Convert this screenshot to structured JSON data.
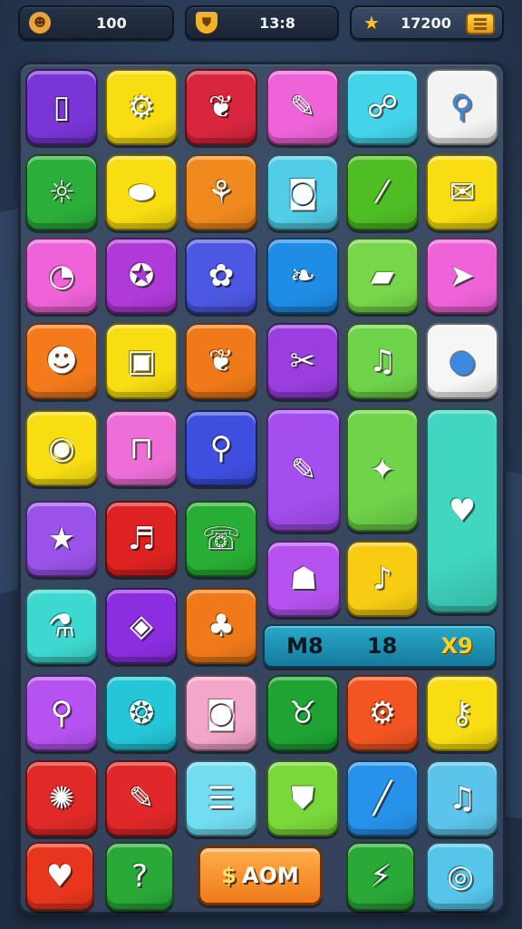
{
  "stats": {
    "lives": {
      "value": "100",
      "icon": "face-icon"
    },
    "timer": {
      "value": "13:8",
      "icon": "shield-icon"
    },
    "coins": {
      "value": "17200",
      "icon": "star-icon"
    }
  },
  "combo": {
    "left": "M8",
    "middle": "18",
    "multiplier": "X9"
  },
  "action_button": {
    "icon": "$",
    "label": "AOM"
  },
  "tiles": [
    {
      "id": "phone",
      "color": "#7a35d6",
      "glyph": "▯"
    },
    {
      "id": "gear",
      "color": "#f7dd12",
      "glyph": "⚙"
    },
    {
      "id": "leaf",
      "color": "#d8263e",
      "glyph": "❦"
    },
    {
      "id": "pencil",
      "color": "#ee63d8",
      "glyph": "✎"
    },
    {
      "id": "chat",
      "color": "#44d4ea",
      "glyph": "☍"
    },
    {
      "id": "pin",
      "color": "#f3f3f3",
      "glyph": "⚲"
    },
    {
      "id": "sun",
      "color": "#2cae3a",
      "glyph": "☼"
    },
    {
      "id": "tag",
      "color": "#f7dd12",
      "glyph": "⬬"
    },
    {
      "id": "lollipop",
      "color": "#f08a1e",
      "glyph": "⚘"
    },
    {
      "id": "camera",
      "color": "#52cde8",
      "glyph": "◙"
    },
    {
      "id": "brush",
      "color": "#4fbe24",
      "glyph": "⁄"
    },
    {
      "id": "mail",
      "color": "#f7dd12",
      "glyph": "✉"
    },
    {
      "id": "magnifier",
      "color": "#ee63d8",
      "glyph": "◔"
    },
    {
      "id": "bug",
      "color": "#b03ad8",
      "glyph": "✪"
    },
    {
      "id": "cog",
      "color": "#4d58e2",
      "glyph": "✿"
    },
    {
      "id": "feather",
      "color": "#1f8de6",
      "glyph": "❧"
    },
    {
      "id": "page",
      "color": "#77d64a",
      "glyph": "▰"
    },
    {
      "id": "arrow",
      "color": "#ee63d8",
      "glyph": "➤"
    },
    {
      "id": "lion",
      "color": "#f47a1c",
      "glyph": "☻"
    },
    {
      "id": "photo",
      "color": "#f7dd12",
      "glyph": "▣"
    },
    {
      "id": "leaf2",
      "color": "#f07a1a",
      "glyph": "❦"
    },
    {
      "id": "tools",
      "color": "#9a3ee0",
      "glyph": "✂"
    },
    {
      "id": "music",
      "color": "#6fd44a",
      "glyph": "♫"
    },
    {
      "id": "bubble",
      "color": "#f6f6f6",
      "glyph": "●"
    },
    {
      "id": "medal",
      "color": "#f7dd12",
      "glyph": "◉"
    },
    {
      "id": "chair",
      "color": "#ee6ed8",
      "glyph": "⊓"
    },
    {
      "id": "location",
      "color": "#3e4fe0",
      "glyph": "⚲"
    },
    {
      "id": "marker",
      "color": "#a44ef0",
      "glyph": "✎"
    },
    {
      "id": "butterfly",
      "color": "#6fd44a",
      "glyph": "✦"
    },
    {
      "id": "heart-bubble",
      "color": "#40d6c0",
      "glyph": "♥"
    },
    {
      "id": "star",
      "color": "#9a52e8",
      "glyph": "★"
    },
    {
      "id": "notes",
      "color": "#de2222",
      "glyph": "♬"
    },
    {
      "id": "chat2",
      "color": "#28ae34",
      "glyph": "☏"
    },
    {
      "id": "robot",
      "color": "#b552f0",
      "glyph": "☗"
    },
    {
      "id": "music2",
      "color": "#f7cc12",
      "glyph": "♪"
    },
    {
      "id": "tube",
      "color": "#3dd8d0",
      "glyph": "⚗"
    },
    {
      "id": "ghost",
      "color": "#8a2ee0",
      "glyph": "◈"
    },
    {
      "id": "cherry",
      "color": "#f07a1a",
      "glyph": "♣"
    },
    {
      "id": "search",
      "color": "#b552f0",
      "glyph": "⚲"
    },
    {
      "id": "shell",
      "color": "#24c6d8",
      "glyph": "❂"
    },
    {
      "id": "camera2",
      "color": "#f4a6c8",
      "glyph": "◙"
    },
    {
      "id": "piggy",
      "color": "#1fa434",
      "glyph": "♉"
    },
    {
      "id": "gadget",
      "color": "#f25522",
      "glyph": "⚙"
    },
    {
      "id": "key",
      "color": "#f7dd12",
      "glyph": "⚷"
    },
    {
      "id": "gear2",
      "color": "#e02a28",
      "glyph": "✺"
    },
    {
      "id": "note",
      "color": "#e0282a",
      "glyph": "✎"
    },
    {
      "id": "list",
      "color": "#72dcf0",
      "glyph": "☰"
    },
    {
      "id": "tooth",
      "color": "#7ad83a",
      "glyph": "⛊"
    },
    {
      "id": "pen",
      "color": "#2792ea",
      "glyph": "╱"
    },
    {
      "id": "music3",
      "color": "#5cc4ea",
      "glyph": "♫"
    },
    {
      "id": "heart",
      "color": "#e8361e",
      "glyph": "♥"
    },
    {
      "id": "question",
      "color": "#2aa838",
      "glyph": "?"
    },
    {
      "id": "bolt",
      "color": "#2aa838",
      "glyph": "⚡"
    },
    {
      "id": "ring",
      "color": "#55c6ea",
      "glyph": "◎"
    },
    {
      "id": "heart2",
      "color": "#b03ad8",
      "glyph": "♥"
    }
  ]
}
